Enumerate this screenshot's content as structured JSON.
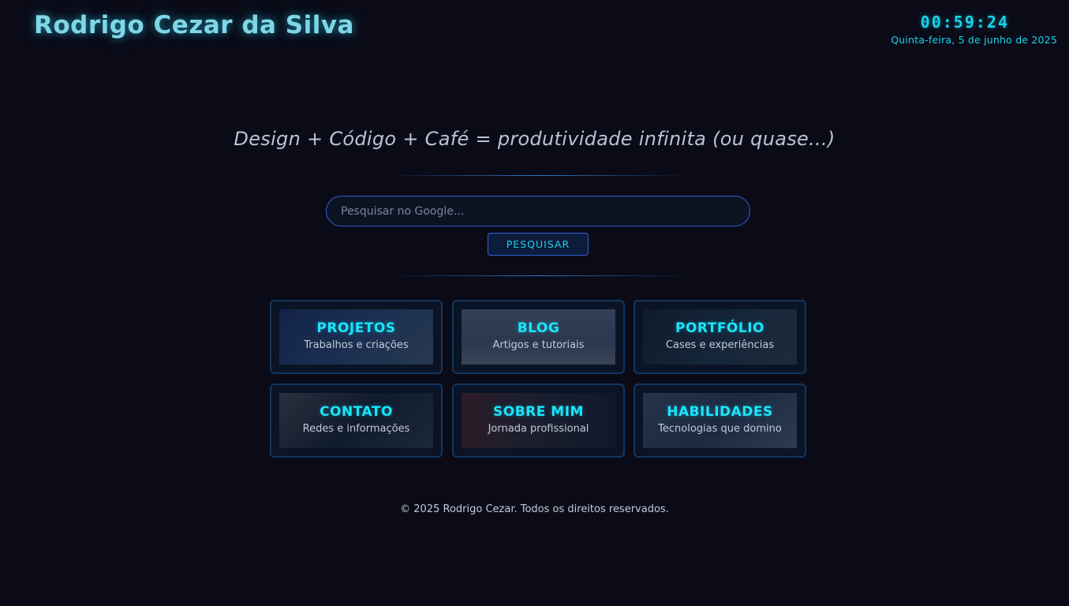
{
  "header": {
    "title": "Rodrigo Cezar da Silva",
    "clock_time": "00:59:24",
    "clock_date": "Quinta-feira, 5 de junho de 2025"
  },
  "tagline": "Design + Código + Café = produtividade infinita (ou quase...)",
  "search": {
    "placeholder": "Pesquisar no Google...",
    "value": "",
    "button_label": "PESQUISAR"
  },
  "cards": [
    {
      "title": "PROJETOS",
      "subtitle": "Trabalhos e criações"
    },
    {
      "title": "BLOG",
      "subtitle": "Artigos e tutoriais"
    },
    {
      "title": "PORTFÓLIO",
      "subtitle": "Cases e experiências"
    },
    {
      "title": "CONTATO",
      "subtitle": "Redes e informações"
    },
    {
      "title": "SOBRE MIM",
      "subtitle": "Jornada profissional"
    },
    {
      "title": "HABILIDADES",
      "subtitle": "Tecnologias que domino"
    }
  ],
  "footer": {
    "text": "© 2025 Rodrigo Cezar. Todos os direitos reservados."
  },
  "colors": {
    "background": "#0b0b18",
    "accent": "#19e6ff",
    "border": "#2f5fd0"
  }
}
